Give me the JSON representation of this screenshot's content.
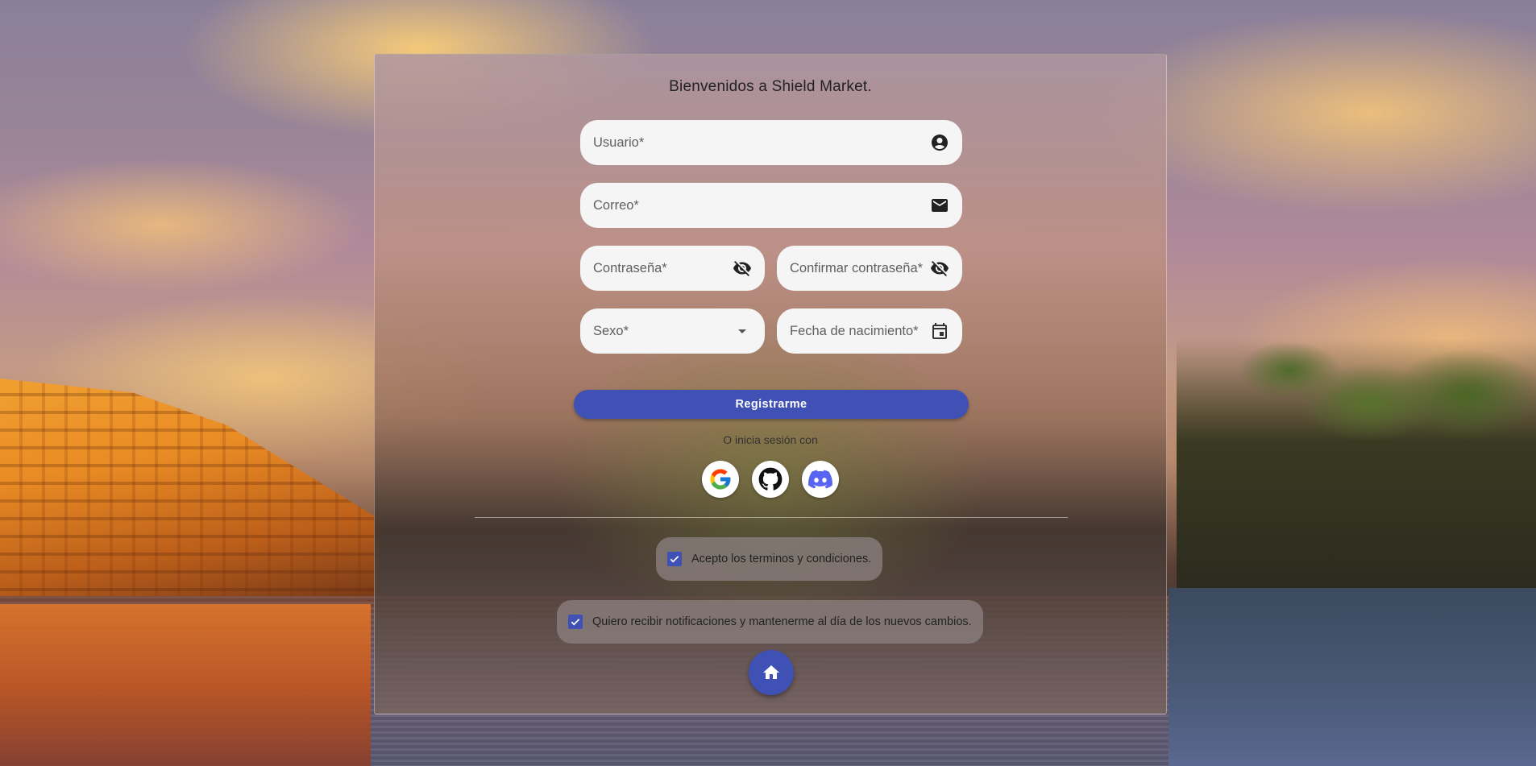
{
  "title": "Bienvenidos a Shield Market.",
  "fields": {
    "usuario": "Usuario*",
    "correo": "Correo*",
    "contrasena": "Contraseña*",
    "confirmar": "Confirmar contraseña*",
    "sexo": "Sexo*",
    "fecha": "Fecha de nacimiento*"
  },
  "register_label": "Registrarme",
  "alt_login_text": "O inicia sesión con",
  "social": [
    "google-icon",
    "github-icon",
    "discord-icon"
  ],
  "checkboxes": {
    "terms": {
      "label": "Acepto los terminos y condiciones.",
      "checked": true
    },
    "notifications": {
      "label": "Quiero recibir notificaciones y mantenerme al día de los nuevos cambios.",
      "checked": true
    }
  },
  "colors": {
    "primary": "#3f51b5",
    "field_bg": "#f5f5f5"
  }
}
